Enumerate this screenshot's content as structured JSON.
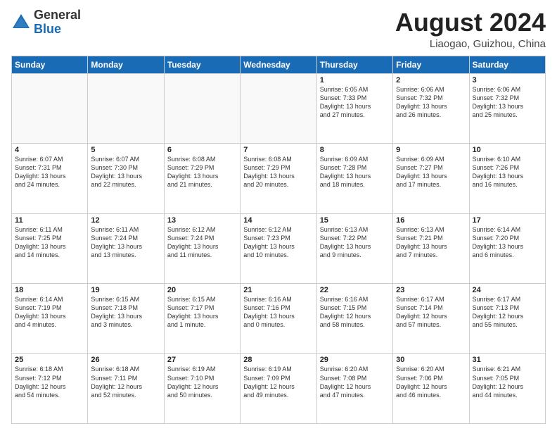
{
  "header": {
    "logo_general": "General",
    "logo_blue": "Blue",
    "month_title": "August 2024",
    "location": "Liaogao, Guizhou, China"
  },
  "weekdays": [
    "Sunday",
    "Monday",
    "Tuesday",
    "Wednesday",
    "Thursday",
    "Friday",
    "Saturday"
  ],
  "weeks": [
    [
      {
        "day": "",
        "info": ""
      },
      {
        "day": "",
        "info": ""
      },
      {
        "day": "",
        "info": ""
      },
      {
        "day": "",
        "info": ""
      },
      {
        "day": "1",
        "info": "Sunrise: 6:05 AM\nSunset: 7:33 PM\nDaylight: 13 hours\nand 27 minutes."
      },
      {
        "day": "2",
        "info": "Sunrise: 6:06 AM\nSunset: 7:32 PM\nDaylight: 13 hours\nand 26 minutes."
      },
      {
        "day": "3",
        "info": "Sunrise: 6:06 AM\nSunset: 7:32 PM\nDaylight: 13 hours\nand 25 minutes."
      }
    ],
    [
      {
        "day": "4",
        "info": "Sunrise: 6:07 AM\nSunset: 7:31 PM\nDaylight: 13 hours\nand 24 minutes."
      },
      {
        "day": "5",
        "info": "Sunrise: 6:07 AM\nSunset: 7:30 PM\nDaylight: 13 hours\nand 22 minutes."
      },
      {
        "day": "6",
        "info": "Sunrise: 6:08 AM\nSunset: 7:29 PM\nDaylight: 13 hours\nand 21 minutes."
      },
      {
        "day": "7",
        "info": "Sunrise: 6:08 AM\nSunset: 7:29 PM\nDaylight: 13 hours\nand 20 minutes."
      },
      {
        "day": "8",
        "info": "Sunrise: 6:09 AM\nSunset: 7:28 PM\nDaylight: 13 hours\nand 18 minutes."
      },
      {
        "day": "9",
        "info": "Sunrise: 6:09 AM\nSunset: 7:27 PM\nDaylight: 13 hours\nand 17 minutes."
      },
      {
        "day": "10",
        "info": "Sunrise: 6:10 AM\nSunset: 7:26 PM\nDaylight: 13 hours\nand 16 minutes."
      }
    ],
    [
      {
        "day": "11",
        "info": "Sunrise: 6:11 AM\nSunset: 7:25 PM\nDaylight: 13 hours\nand 14 minutes."
      },
      {
        "day": "12",
        "info": "Sunrise: 6:11 AM\nSunset: 7:24 PM\nDaylight: 13 hours\nand 13 minutes."
      },
      {
        "day": "13",
        "info": "Sunrise: 6:12 AM\nSunset: 7:24 PM\nDaylight: 13 hours\nand 11 minutes."
      },
      {
        "day": "14",
        "info": "Sunrise: 6:12 AM\nSunset: 7:23 PM\nDaylight: 13 hours\nand 10 minutes."
      },
      {
        "day": "15",
        "info": "Sunrise: 6:13 AM\nSunset: 7:22 PM\nDaylight: 13 hours\nand 9 minutes."
      },
      {
        "day": "16",
        "info": "Sunrise: 6:13 AM\nSunset: 7:21 PM\nDaylight: 13 hours\nand 7 minutes."
      },
      {
        "day": "17",
        "info": "Sunrise: 6:14 AM\nSunset: 7:20 PM\nDaylight: 13 hours\nand 6 minutes."
      }
    ],
    [
      {
        "day": "18",
        "info": "Sunrise: 6:14 AM\nSunset: 7:19 PM\nDaylight: 13 hours\nand 4 minutes."
      },
      {
        "day": "19",
        "info": "Sunrise: 6:15 AM\nSunset: 7:18 PM\nDaylight: 13 hours\nand 3 minutes."
      },
      {
        "day": "20",
        "info": "Sunrise: 6:15 AM\nSunset: 7:17 PM\nDaylight: 13 hours\nand 1 minute."
      },
      {
        "day": "21",
        "info": "Sunrise: 6:16 AM\nSunset: 7:16 PM\nDaylight: 13 hours\nand 0 minutes."
      },
      {
        "day": "22",
        "info": "Sunrise: 6:16 AM\nSunset: 7:15 PM\nDaylight: 12 hours\nand 58 minutes."
      },
      {
        "day": "23",
        "info": "Sunrise: 6:17 AM\nSunset: 7:14 PM\nDaylight: 12 hours\nand 57 minutes."
      },
      {
        "day": "24",
        "info": "Sunrise: 6:17 AM\nSunset: 7:13 PM\nDaylight: 12 hours\nand 55 minutes."
      }
    ],
    [
      {
        "day": "25",
        "info": "Sunrise: 6:18 AM\nSunset: 7:12 PM\nDaylight: 12 hours\nand 54 minutes."
      },
      {
        "day": "26",
        "info": "Sunrise: 6:18 AM\nSunset: 7:11 PM\nDaylight: 12 hours\nand 52 minutes."
      },
      {
        "day": "27",
        "info": "Sunrise: 6:19 AM\nSunset: 7:10 PM\nDaylight: 12 hours\nand 50 minutes."
      },
      {
        "day": "28",
        "info": "Sunrise: 6:19 AM\nSunset: 7:09 PM\nDaylight: 12 hours\nand 49 minutes."
      },
      {
        "day": "29",
        "info": "Sunrise: 6:20 AM\nSunset: 7:08 PM\nDaylight: 12 hours\nand 47 minutes."
      },
      {
        "day": "30",
        "info": "Sunrise: 6:20 AM\nSunset: 7:06 PM\nDaylight: 12 hours\nand 46 minutes."
      },
      {
        "day": "31",
        "info": "Sunrise: 6:21 AM\nSunset: 7:05 PM\nDaylight: 12 hours\nand 44 minutes."
      }
    ]
  ]
}
